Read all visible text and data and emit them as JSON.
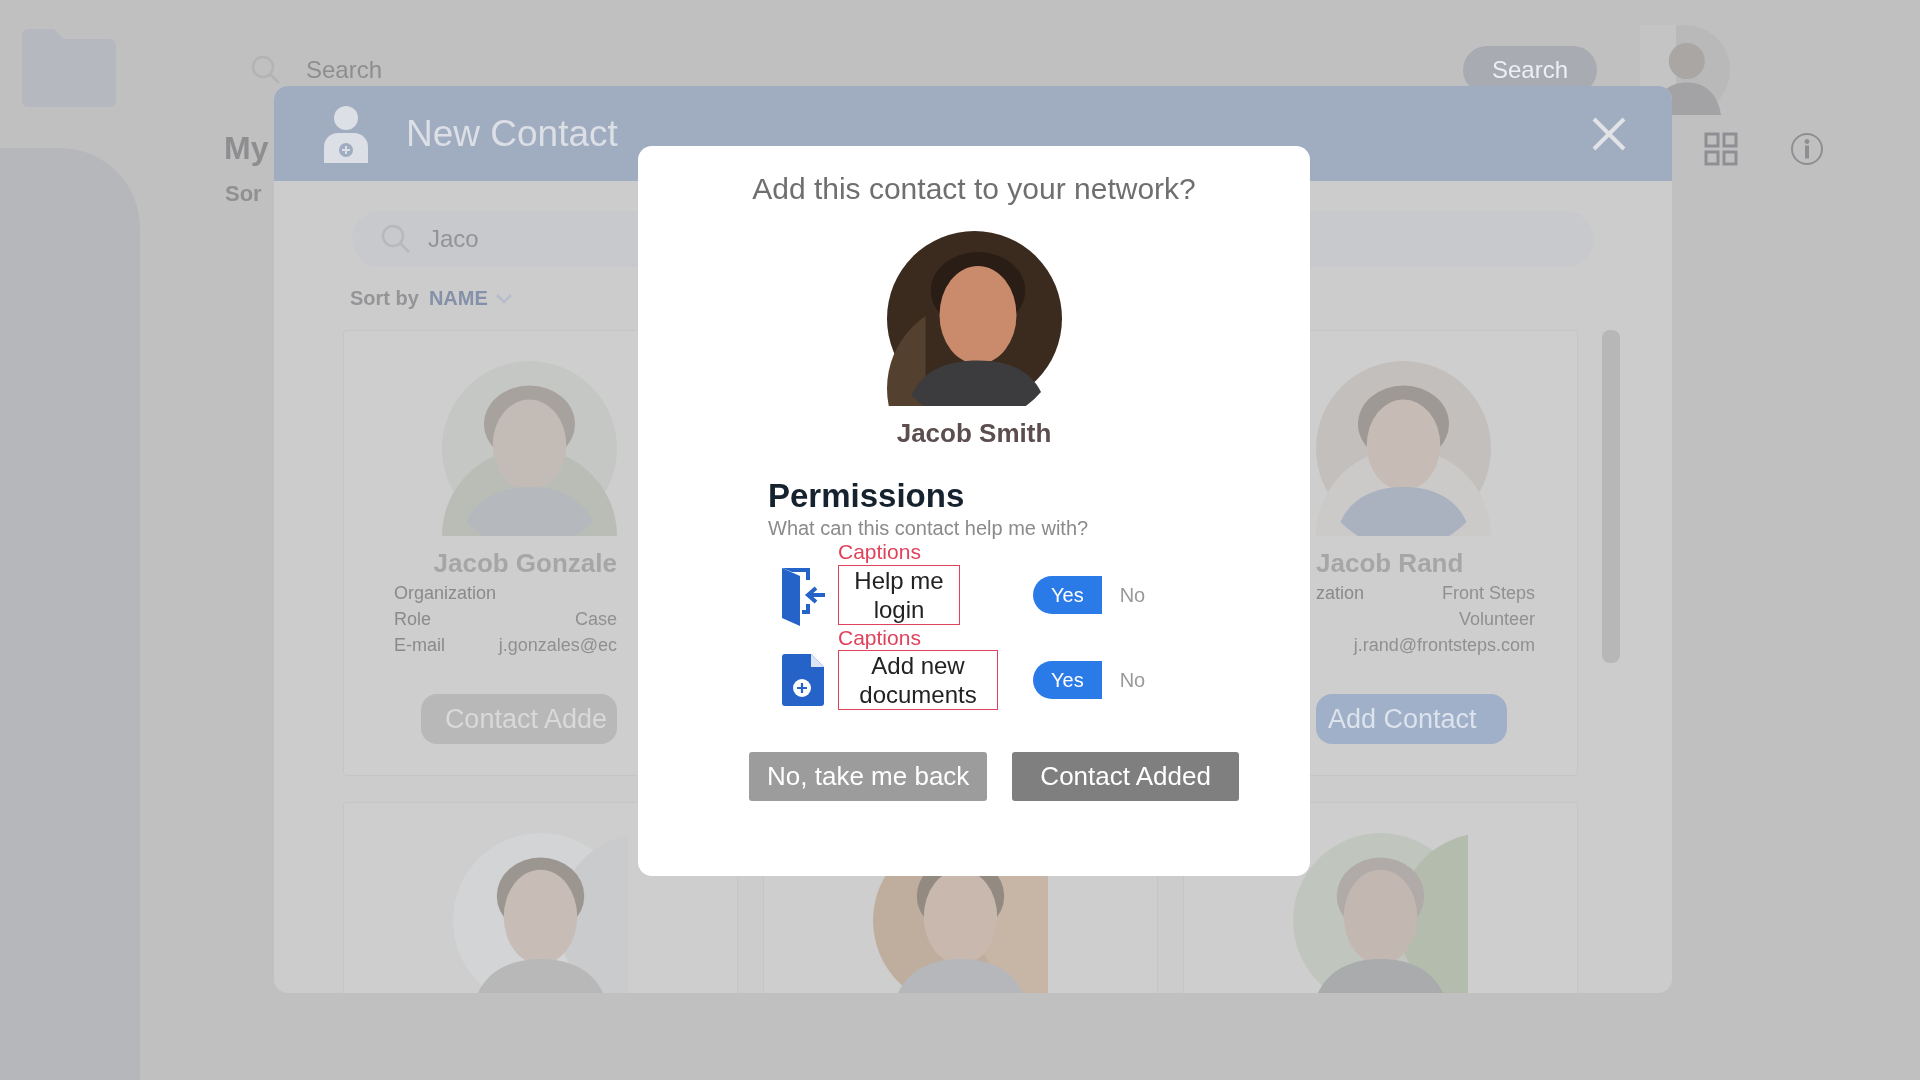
{
  "app": {
    "search": {
      "placeholder": "Search"
    },
    "search_button": "Search",
    "page_title": "My",
    "sort_fragment": "Sor"
  },
  "new_contact_dialog": {
    "title": "New Contact",
    "search": {
      "value": "Jaco"
    },
    "sort": {
      "label": "Sort by",
      "value": "NAME"
    },
    "top_row": [
      {
        "name": "Jacob Gonzale",
        "fields": [
          {
            "label": "Organization"
          },
          {
            "label": "Role",
            "value": "Case"
          },
          {
            "label": "E-mail",
            "value": "j.gonzales@ec"
          }
        ],
        "button": {
          "label": "Contact Adde",
          "kind": "added"
        }
      },
      {
        "name": "Jacob Rand",
        "fields": [
          {
            "label": "zation",
            "value": "Front Steps"
          },
          {
            "value": "Volunteer"
          },
          {
            "value": "j.rand@frontsteps.com"
          }
        ],
        "button": {
          "label": "Add Contact",
          "kind": "add"
        }
      }
    ]
  },
  "confirm_dialog": {
    "title": "Add this contact to your network?",
    "contact_name": "Jacob Smith",
    "permissions_title": "Permissions",
    "permissions_subtitle": "What can this contact help me with?",
    "permissions": [
      {
        "kind": "login",
        "caption": "Captions",
        "label": "Help me login",
        "options": [
          {
            "label": "Yes",
            "selected": true
          },
          {
            "label": "No",
            "selected": false
          }
        ]
      },
      {
        "kind": "document",
        "caption": "Captions",
        "label": "Add new documents",
        "options": [
          {
            "label": "Yes",
            "selected": true
          },
          {
            "label": "No",
            "selected": false
          }
        ]
      }
    ],
    "buttons": [
      {
        "label": "No, take me back",
        "kind": "secondary"
      },
      {
        "label": "Contact Added",
        "kind": "primary"
      }
    ]
  }
}
